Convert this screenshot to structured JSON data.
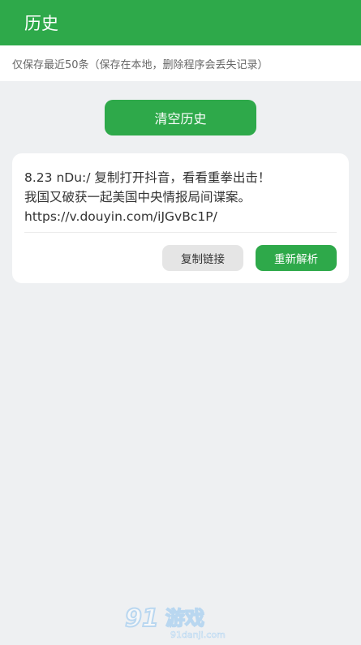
{
  "header": {
    "title": "历史"
  },
  "notice": {
    "text": "仅保存最近50条（保存在本地，删除程序会丢失记录）"
  },
  "actions": {
    "clear_label": "清空历史"
  },
  "history": [
    {
      "line1": "8.23 nDu:/ 复制打开抖音，看看重拳出击！",
      "line2": "我国又破获一起美国中央情报局间谍案。",
      "line3": "https://v.douyin.com/iJGvBc1P/",
      "copy_label": "复制链接",
      "reparse_label": "重新解析"
    }
  ],
  "watermark": {
    "logo": "91游戏",
    "site": "91danji.com"
  },
  "colors": {
    "primary": "#2ea94a",
    "background": "#eef0f2",
    "card": "#ffffff"
  }
}
